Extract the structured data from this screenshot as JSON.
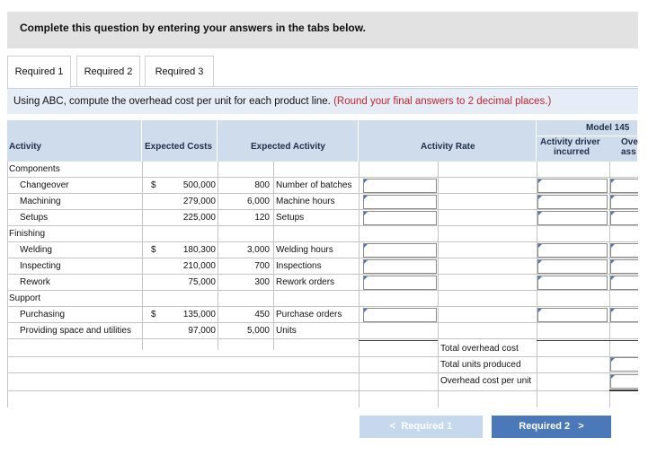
{
  "header": {
    "text": "Complete this question by entering your answers in the tabs below."
  },
  "tabs": [
    {
      "label": "Required 1",
      "active": true
    },
    {
      "label": "Required 2",
      "active": false
    },
    {
      "label": "Required 3",
      "active": false
    }
  ],
  "instruction": {
    "main": "Using ABC, compute the overhead cost per unit for each product line.",
    "note": "(Round your final answers to 2 decimal places.)"
  },
  "table": {
    "columns": {
      "activity": "Activity",
      "expected_costs": "Expected Costs",
      "expected_activity": "Expected Activity",
      "activity_rate": "Activity Rate",
      "model": "Model 145",
      "activity_driver_line1": "Activity driver",
      "activity_driver_line2": "incurred",
      "overhead_line1": "Ove",
      "overhead_line2": "ass"
    },
    "groups": [
      "Components",
      "Finishing",
      "Support"
    ],
    "dollar_sign": "$",
    "rows": [
      {
        "activity": "Changeover",
        "cost": "500,000",
        "qty": "800",
        "driver": "Number of batches"
      },
      {
        "activity": "Machining",
        "cost": "279,000",
        "qty": "6,000",
        "driver": "Machine hours"
      },
      {
        "activity": "Setups",
        "cost": "225,000",
        "qty": "120",
        "driver": "Setups"
      },
      {
        "activity": "Welding",
        "cost": "180,300",
        "qty": "3,000",
        "driver": "Welding hours"
      },
      {
        "activity": "Inspecting",
        "cost": "210,000",
        "qty": "700",
        "driver": "Inspections"
      },
      {
        "activity": "Rework",
        "cost": "75,000",
        "qty": "300",
        "driver": "Rework orders"
      },
      {
        "activity": "Purchasing",
        "cost": "135,000",
        "qty": "450",
        "driver": "Purchase orders"
      },
      {
        "activity": "Providing space and utilities",
        "cost": "97,000",
        "qty": "5,000",
        "driver": "Units"
      }
    ],
    "totals": {
      "total_overhead": "Total overhead cost",
      "total_units": "Total units produced",
      "per_unit": "Overhead cost per unit"
    }
  },
  "nav": {
    "prev": "Required 1",
    "next": "Required 2",
    "prev_glyph": "<",
    "next_glyph": ">"
  },
  "colors": {
    "accent": "#4a78b8",
    "header_bg": "#cfdcec",
    "note": "#c0262c"
  }
}
